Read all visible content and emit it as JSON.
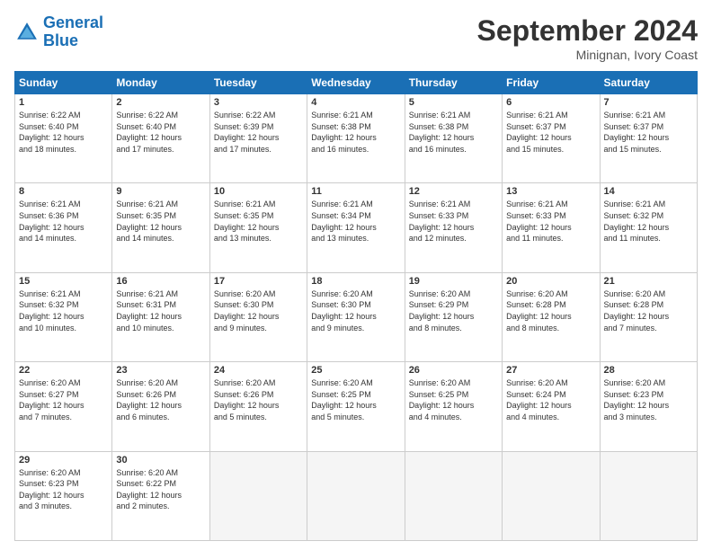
{
  "header": {
    "logo_line1": "General",
    "logo_line2": "Blue",
    "month_title": "September 2024",
    "location": "Minignan, Ivory Coast"
  },
  "days_of_week": [
    "Sunday",
    "Monday",
    "Tuesday",
    "Wednesday",
    "Thursday",
    "Friday",
    "Saturday"
  ],
  "weeks": [
    [
      {
        "day": "1",
        "info": "Sunrise: 6:22 AM\nSunset: 6:40 PM\nDaylight: 12 hours\nand 18 minutes."
      },
      {
        "day": "2",
        "info": "Sunrise: 6:22 AM\nSunset: 6:40 PM\nDaylight: 12 hours\nand 17 minutes."
      },
      {
        "day": "3",
        "info": "Sunrise: 6:22 AM\nSunset: 6:39 PM\nDaylight: 12 hours\nand 17 minutes."
      },
      {
        "day": "4",
        "info": "Sunrise: 6:21 AM\nSunset: 6:38 PM\nDaylight: 12 hours\nand 16 minutes."
      },
      {
        "day": "5",
        "info": "Sunrise: 6:21 AM\nSunset: 6:38 PM\nDaylight: 12 hours\nand 16 minutes."
      },
      {
        "day": "6",
        "info": "Sunrise: 6:21 AM\nSunset: 6:37 PM\nDaylight: 12 hours\nand 15 minutes."
      },
      {
        "day": "7",
        "info": "Sunrise: 6:21 AM\nSunset: 6:37 PM\nDaylight: 12 hours\nand 15 minutes."
      }
    ],
    [
      {
        "day": "8",
        "info": "Sunrise: 6:21 AM\nSunset: 6:36 PM\nDaylight: 12 hours\nand 14 minutes."
      },
      {
        "day": "9",
        "info": "Sunrise: 6:21 AM\nSunset: 6:35 PM\nDaylight: 12 hours\nand 14 minutes."
      },
      {
        "day": "10",
        "info": "Sunrise: 6:21 AM\nSunset: 6:35 PM\nDaylight: 12 hours\nand 13 minutes."
      },
      {
        "day": "11",
        "info": "Sunrise: 6:21 AM\nSunset: 6:34 PM\nDaylight: 12 hours\nand 13 minutes."
      },
      {
        "day": "12",
        "info": "Sunrise: 6:21 AM\nSunset: 6:33 PM\nDaylight: 12 hours\nand 12 minutes."
      },
      {
        "day": "13",
        "info": "Sunrise: 6:21 AM\nSunset: 6:33 PM\nDaylight: 12 hours\nand 11 minutes."
      },
      {
        "day": "14",
        "info": "Sunrise: 6:21 AM\nSunset: 6:32 PM\nDaylight: 12 hours\nand 11 minutes."
      }
    ],
    [
      {
        "day": "15",
        "info": "Sunrise: 6:21 AM\nSunset: 6:32 PM\nDaylight: 12 hours\nand 10 minutes."
      },
      {
        "day": "16",
        "info": "Sunrise: 6:21 AM\nSunset: 6:31 PM\nDaylight: 12 hours\nand 10 minutes."
      },
      {
        "day": "17",
        "info": "Sunrise: 6:20 AM\nSunset: 6:30 PM\nDaylight: 12 hours\nand 9 minutes."
      },
      {
        "day": "18",
        "info": "Sunrise: 6:20 AM\nSunset: 6:30 PM\nDaylight: 12 hours\nand 9 minutes."
      },
      {
        "day": "19",
        "info": "Sunrise: 6:20 AM\nSunset: 6:29 PM\nDaylight: 12 hours\nand 8 minutes."
      },
      {
        "day": "20",
        "info": "Sunrise: 6:20 AM\nSunset: 6:28 PM\nDaylight: 12 hours\nand 8 minutes."
      },
      {
        "day": "21",
        "info": "Sunrise: 6:20 AM\nSunset: 6:28 PM\nDaylight: 12 hours\nand 7 minutes."
      }
    ],
    [
      {
        "day": "22",
        "info": "Sunrise: 6:20 AM\nSunset: 6:27 PM\nDaylight: 12 hours\nand 7 minutes."
      },
      {
        "day": "23",
        "info": "Sunrise: 6:20 AM\nSunset: 6:26 PM\nDaylight: 12 hours\nand 6 minutes."
      },
      {
        "day": "24",
        "info": "Sunrise: 6:20 AM\nSunset: 6:26 PM\nDaylight: 12 hours\nand 5 minutes."
      },
      {
        "day": "25",
        "info": "Sunrise: 6:20 AM\nSunset: 6:25 PM\nDaylight: 12 hours\nand 5 minutes."
      },
      {
        "day": "26",
        "info": "Sunrise: 6:20 AM\nSunset: 6:25 PM\nDaylight: 12 hours\nand 4 minutes."
      },
      {
        "day": "27",
        "info": "Sunrise: 6:20 AM\nSunset: 6:24 PM\nDaylight: 12 hours\nand 4 minutes."
      },
      {
        "day": "28",
        "info": "Sunrise: 6:20 AM\nSunset: 6:23 PM\nDaylight: 12 hours\nand 3 minutes."
      }
    ],
    [
      {
        "day": "29",
        "info": "Sunrise: 6:20 AM\nSunset: 6:23 PM\nDaylight: 12 hours\nand 3 minutes."
      },
      {
        "day": "30",
        "info": "Sunrise: 6:20 AM\nSunset: 6:22 PM\nDaylight: 12 hours\nand 2 minutes."
      },
      {
        "day": "",
        "info": ""
      },
      {
        "day": "",
        "info": ""
      },
      {
        "day": "",
        "info": ""
      },
      {
        "day": "",
        "info": ""
      },
      {
        "day": "",
        "info": ""
      }
    ]
  ]
}
